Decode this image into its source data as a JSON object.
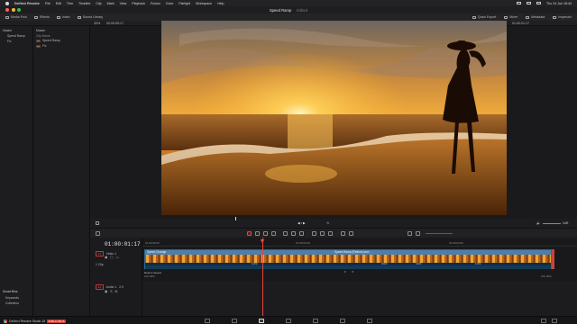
{
  "menubar": {
    "app": "DaVinci Resolve",
    "items": [
      "File",
      "Edit",
      "Trim",
      "Timeline",
      "Clip",
      "Mark",
      "View",
      "Playback",
      "Fusion",
      "Color",
      "Fairlight",
      "Workspace",
      "Help"
    ],
    "clock": "Thu 24 Jun 18:44"
  },
  "window": {
    "title": "Speed Ramp",
    "status": "Edited"
  },
  "toolbar": {
    "left": [
      "Media Pool",
      "Effects",
      "Index",
      "Sound Library"
    ],
    "right": [
      "Quick Export",
      "Mixer",
      "Metadata",
      "Inspector"
    ]
  },
  "subbar": {
    "zoom": "30%",
    "source_tc": "00:00:05:17",
    "timeline_name": "Speed Ramp",
    "record_tc": "01:00:01:17"
  },
  "media_pool": {
    "root": "Master",
    "bins": [
      "Speed Ramp",
      "Fix"
    ],
    "smart_bins_label": "Smart Bins",
    "smart_bins": [
      "Keywords",
      "Collection"
    ]
  },
  "media_list": {
    "header": "Master",
    "column": "Clip Name",
    "clips": [
      "Speed Ramp",
      "Fix"
    ]
  },
  "timeline": {
    "timecode": "01:00:01:17",
    "ruler": [
      "01:00:00:00",
      "01:00:02:00",
      "01:00:04:00"
    ],
    "video_track": {
      "badge": "V1",
      "name": "Video 1",
      "count": "1 Clip"
    },
    "audio_track": {
      "badge": "A1",
      "name": "Audio 1",
      "level": "2.0"
    },
    "clip_titles": [
      "Speed Change",
      "Speed Ramp (Retime).mov"
    ],
    "speed_labels": [
      "100%",
      "200%",
      "100%",
      "100%"
    ],
    "retime_label": "Retime Speed",
    "retime_values": [
      "100.00%",
      "100.00%"
    ]
  },
  "transport": {
    "volume": "0dB"
  },
  "bottom": {
    "product": "DaVinci Resolve Studio 18",
    "badge": "PUBLIC BETA"
  }
}
